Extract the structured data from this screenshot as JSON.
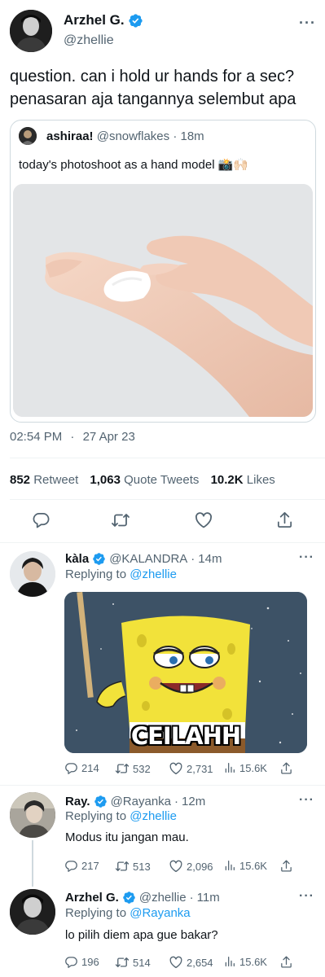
{
  "main_tweet": {
    "author_name": "Arzhel G.",
    "author_handle": "@zhellie",
    "text_line1": "question. can i hold ur hands for a sec?",
    "text_line2": "penasaran aja tangannya selembut apa",
    "more_label": "···",
    "quote": {
      "author_name": "ashiraa!",
      "author_handle": "@snowflakes",
      "separator": "·",
      "time": "18m",
      "text": "today's photoshoot as a hand model 📸🙌🏻"
    },
    "time": "02:54 PM",
    "dot": "·",
    "date": "27 Apr 23",
    "stats": {
      "retweets_count": "852",
      "retweets_label": "Retweet",
      "quotes_count": "1,063",
      "quotes_label": "Quote Tweets",
      "likes_count": "10.2K",
      "likes_label": "Likes"
    }
  },
  "replies": [
    {
      "author_name": "kàla",
      "author_handle": "@KALANDRA",
      "separator": "·",
      "time": "14m",
      "replying_prefix": "Replying to",
      "replying_to": "@zhellie",
      "meme_caption": "CEILAHH",
      "reply_count": "214",
      "retweet_count": "532",
      "like_count": "2,731",
      "view_count": "15.6K"
    },
    {
      "author_name": "Ray.",
      "author_handle": "@Rayanka",
      "separator": "·",
      "time": "12m",
      "replying_prefix": "Replying to",
      "replying_to": "@zhellie",
      "text": "Modus itu jangan mau.",
      "reply_count": "217",
      "retweet_count": "513",
      "like_count": "2,096",
      "view_count": "15.6K"
    },
    {
      "author_name": "Arzhel G.",
      "author_handle": "@zhellie",
      "separator": "·",
      "time": "11m",
      "replying_prefix": "Replying to",
      "replying_to": "@Rayanka",
      "text": "lo pilih diem apa gue bakar?",
      "reply_count": "196",
      "retweet_count": "514",
      "like_count": "2,654",
      "view_count": "15.6K"
    }
  ],
  "colors": {
    "accent": "#1d9bf0",
    "muted": "#536471",
    "text": "#0f1419",
    "divider": "#eff3f4",
    "meme_background": "#3d5266",
    "spongebob_yellow": "#f2e23a"
  },
  "icons": [
    "verified-badge-icon",
    "more-icon",
    "reply-icon",
    "retweet-icon",
    "like-icon",
    "share-icon",
    "views-icon"
  ]
}
